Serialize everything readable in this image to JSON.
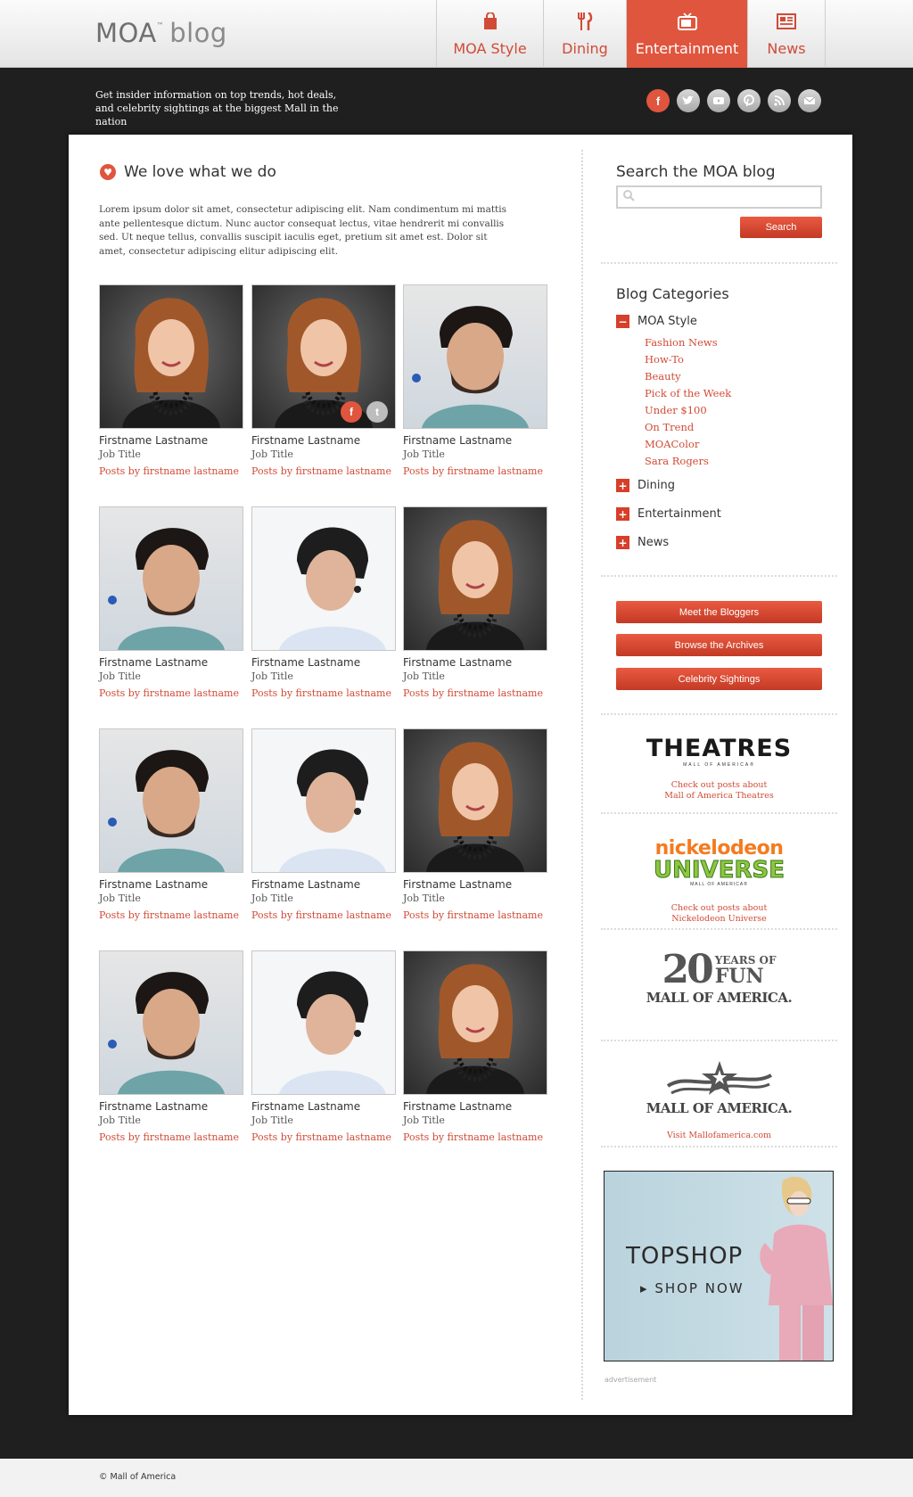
{
  "header": {
    "logo_main": "MOA",
    "logo_tm": "™",
    "logo_blog": "blog",
    "nav": [
      {
        "label": "MOA Style",
        "icon": "shopping-bag-icon"
      },
      {
        "label": "Dining",
        "icon": "fork-knife-icon"
      },
      {
        "label": "Entertainment",
        "icon": "tv-icon",
        "active": true
      },
      {
        "label": "News",
        "icon": "newspaper-icon"
      }
    ]
  },
  "strip": {
    "tagline": "Get insider information on top trends, hot deals, and celebrity sightings at the biggest Mall in the nation",
    "social": [
      "facebook-icon",
      "twitter-icon",
      "youtube-icon",
      "pinterest-icon",
      "rss-icon",
      "email-icon"
    ]
  },
  "main": {
    "title": "We love what we do",
    "intro": "Lorem ipsum dolor sit amet, consectetur adipiscing elit. Nam condimentum mi mattis ante pellentesque dictum. Nunc auctor consequat lectus, vitae hendrerit mi convallis sed. Ut neque tellus, convallis suscipit iaculis eget, pretium sit amet est. Dolor sit amet, consectetur adipiscing elitur adipiscing elit.",
    "people": [
      {
        "name": "Firstname Lastname",
        "title": "Job Title",
        "link": "Posts by firstname lastname",
        "photo": "woman"
      },
      {
        "name": "Firstname Lastname",
        "title": "Job Title",
        "link": "Posts by firstname lastname",
        "photo": "woman"
      },
      {
        "name": "Firstname Lastname",
        "title": "Job Title",
        "link": "Posts by firstname lastname",
        "photo": "man1"
      },
      {
        "name": "Firstname Lastname",
        "title": "Job Title",
        "link": "Posts by firstname lastname",
        "photo": "man1"
      },
      {
        "name": "Firstname Lastname",
        "title": "Job Title",
        "link": "Posts by firstname lastname",
        "photo": "man2"
      },
      {
        "name": "Firstname Lastname",
        "title": "Job Title",
        "link": "Posts by firstname lastname",
        "photo": "woman"
      },
      {
        "name": "Firstname Lastname",
        "title": "Job Title",
        "link": "Posts by firstname lastname",
        "photo": "man1"
      },
      {
        "name": "Firstname Lastname",
        "title": "Job Title",
        "link": "Posts by firstname lastname",
        "photo": "man2"
      },
      {
        "name": "Firstname Lastname",
        "title": "Job Title",
        "link": "Posts by firstname lastname",
        "photo": "woman"
      },
      {
        "name": "Firstname Lastname",
        "title": "Job Title",
        "link": "Posts by firstname lastname",
        "photo": "man1"
      },
      {
        "name": "Firstname Lastname",
        "title": "Job Title",
        "link": "Posts by firstname lastname",
        "photo": "man2"
      },
      {
        "name": "Firstname Lastname",
        "title": "Job Title",
        "link": "Posts by firstname lastname",
        "photo": "woman"
      }
    ]
  },
  "sidebar": {
    "search_title": "Search the MOA blog",
    "search_placeholder": "",
    "search_button": "Search",
    "categories_title": "Blog Categories",
    "categories": [
      {
        "label": "MOA Style",
        "expanded": true,
        "sign": "−"
      },
      {
        "label": "Dining",
        "sign": "+"
      },
      {
        "label": "Entertainment",
        "sign": "+"
      },
      {
        "label": "News",
        "sign": "+"
      }
    ],
    "subcategories": [
      "Fashion News",
      "How-To",
      "Beauty",
      "Pick of the Week",
      "Under $100",
      "On Trend",
      "MOAColor",
      "Sara Rogers"
    ],
    "buttons": [
      "Meet the Bloggers",
      "Browse the Archives",
      "Celebrity Sightings"
    ],
    "theatres": {
      "logo": "THEATRES",
      "sub": "MALL OF AMERICA®",
      "link1": "Check out posts about",
      "link2": "Mall of America Theatres"
    },
    "nick": {
      "line1": "nickelodeon",
      "line2": "UNIVERSE",
      "sub": "MALL OF AMERICA®",
      "link1": "Check out posts about",
      "link2": "Nickelodeon Universe"
    },
    "twenty": {
      "num": "20",
      "years": "YEARS OF",
      "fun": "FUN",
      "moa": "MALL OF AMERICA."
    },
    "moa_logo": {
      "text": "MALL OF AMERICA.",
      "link": "Visit Mallofamerica.com"
    },
    "ad": {
      "brand": "TOPSHOP",
      "cta": "SHOP NOW",
      "label": "advertisement"
    }
  },
  "footer": {
    "copyright": "© Mall of America"
  },
  "colors": {
    "accent": "#e0553e",
    "dark_bg": "#1f1f1f",
    "link": "#d14a36"
  }
}
